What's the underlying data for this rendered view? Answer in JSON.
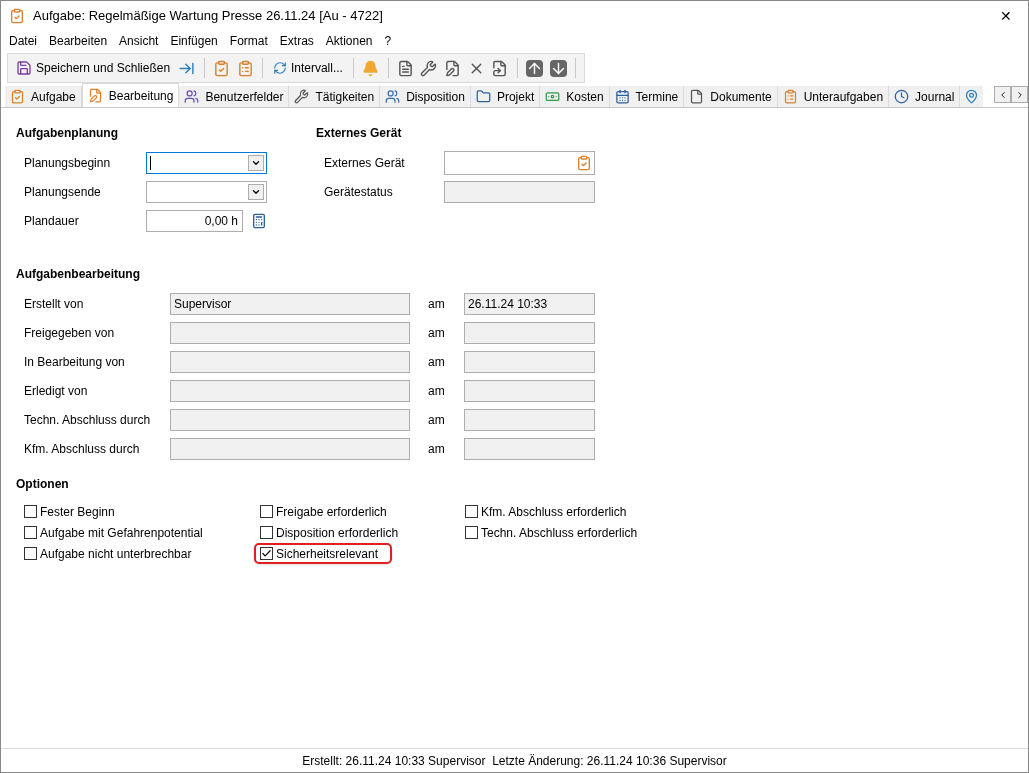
{
  "window": {
    "title": "Aufgabe: Regelmäßige Wartung Presse 26.11.24 [Au - 4722]",
    "close": "✕"
  },
  "menu": [
    "Datei",
    "Bearbeiten",
    "Ansicht",
    "Einfügen",
    "Format",
    "Extras",
    "Aktionen",
    "?"
  ],
  "toolbar": {
    "save": "Speichern und Schließen",
    "interval": "Intervall..."
  },
  "tabs": [
    {
      "label": "Aufgabe",
      "selected": false
    },
    {
      "label": "Bearbeitung",
      "selected": true
    },
    {
      "label": "Benutzerfelder",
      "selected": false
    },
    {
      "label": "Tätigkeiten",
      "selected": false
    },
    {
      "label": "Disposition",
      "selected": false
    },
    {
      "label": "Projekt",
      "selected": false
    },
    {
      "label": "Kosten",
      "selected": false
    },
    {
      "label": "Termine",
      "selected": false
    },
    {
      "label": "Dokumente",
      "selected": false
    },
    {
      "label": "Unteraufgaben",
      "selected": false
    },
    {
      "label": "Journal",
      "selected": false
    }
  ],
  "planning": {
    "title": "Aufgabenplanung",
    "fields": [
      {
        "label": "Planungsbeginn",
        "kind": "dropdown",
        "focused": true
      },
      {
        "label": "Planungsende",
        "kind": "dropdown",
        "focused": false
      },
      {
        "label": "Plandauer",
        "kind": "number",
        "value": "0,00 h",
        "focused": false
      }
    ]
  },
  "device": {
    "title": "Externes Gerät",
    "fields": [
      {
        "label": "Externes Gerät",
        "kind": "picker",
        "disabled": false
      },
      {
        "label": "Gerätestatus",
        "kind": "text",
        "disabled": true
      }
    ]
  },
  "processing": {
    "title": "Aufgabenbearbeitung",
    "rows": [
      {
        "label": "Erstellt von",
        "value": "Supervisor",
        "am": "am",
        "date": "26.11.24 10:33"
      },
      {
        "label": "Freigegeben von",
        "am": "am"
      },
      {
        "label": "In Bearbeitung von",
        "am": "am"
      },
      {
        "label": "Erledigt von",
        "am": "am"
      },
      {
        "label": "Techn. Abschluss durch",
        "am": "am"
      },
      {
        "label": "Kfm. Abschluss durch",
        "am": "am"
      }
    ]
  },
  "options": {
    "title": "Optionen",
    "columns": [
      [
        {
          "label": "Fester Beginn",
          "checked": false,
          "highlighted": false
        },
        {
          "label": "Aufgabe mit Gefahrenpotential",
          "checked": false,
          "highlighted": false
        },
        {
          "label": "Aufgabe nicht unterbrechbar",
          "checked": false,
          "highlighted": false
        }
      ],
      [
        {
          "label": "Freigabe erforderlich",
          "checked": false,
          "highlighted": false
        },
        {
          "label": "Disposition erforderlich",
          "checked": false,
          "highlighted": false
        },
        {
          "label": "Sicherheitsrelevant",
          "checked": true,
          "highlighted": true
        }
      ],
      [
        {
          "label": "Kfm. Abschluss erforderlich",
          "checked": false,
          "highlighted": false
        },
        {
          "label": "Techn. Abschluss erforderlich",
          "checked": false,
          "highlighted": false
        }
      ]
    ]
  },
  "status_bar": "Erstellt: 26.11.24 10:33 Supervisor  Letzte Änderung: 26.11.24 10:36 Supervisor"
}
